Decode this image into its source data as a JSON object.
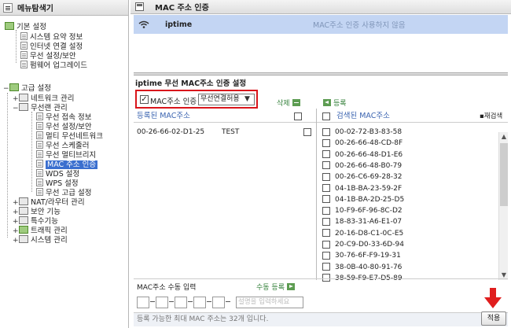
{
  "sidebar": {
    "title": "메뉴탐색기",
    "basic": {
      "label": "기본 설정",
      "items": [
        "시스템 요약 정보",
        "인터넷 연결 설정",
        "무선 설정/보안",
        "펌웨어 업그레이드"
      ]
    },
    "advanced": {
      "label": "고급 설정",
      "network": "네트워크 관리",
      "wireless": {
        "label": "무선랜 관리",
        "items": [
          "무선 접속 정보",
          "무선 설정/보안",
          "멀티 무선네트워크",
          "무선 스케줄러",
          "무선 멀티브리지",
          "MAC 주소 인증",
          "WDS 설정",
          "WPS 설정",
          "무선 고급 설정"
        ]
      },
      "others": [
        "NAT/라우터 관리",
        "보안 기능",
        "특수기능",
        "트래픽 관리",
        "시스템 관리"
      ]
    }
  },
  "main": {
    "title": "MAC 주소 인증",
    "ssid": {
      "name": "iptime",
      "status": "MAC주소 인증 사용하지 않음"
    },
    "section_title": "iptime  무선 MAC주소 인증 설정",
    "enable_label": "MAC주소 인증",
    "mode_select": "무선연결허용",
    "delete_label": "삭제",
    "register_label": "등록",
    "registered_header": "등록된 MAC주소",
    "registered_rows": [
      {
        "mac": "00-26-66-02-D1-25",
        "name": "TEST"
      }
    ],
    "searched_header": "검색된 MAC주소",
    "rescan_label": "재검색",
    "searched_rows": [
      "00-02-72-B3-83-58",
      "00-26-66-48-CD-8F",
      "00-26-66-48-D1-E6",
      "00-26-66-48-B0-79",
      "00-26-C6-69-28-32",
      "04-1B-BA-23-59-2F",
      "04-1B-BA-2D-25-D5",
      "10-F9-6F-96-8C-D2",
      "18-83-31-A6-E1-07",
      "20-16-D8-C1-0C-E5",
      "20-C9-D0-33-6D-94",
      "30-76-6F-F9-19-31",
      "38-0B-40-80-91-76",
      "38-59-F9-E7-D5-89"
    ],
    "manual_label": "MAC주소 수동 입력",
    "manual_register": "수동 등록",
    "desc_placeholder": "설명을 입력하세요",
    "footer": "등록 가능한 최대 MAC 주소는 32개 입니다.",
    "apply": "적용"
  },
  "colors": {
    "accent_red": "#d9151b",
    "selected_row": "#c3d5f3",
    "green": "#33803a",
    "header_blue": "#3b64b0"
  }
}
